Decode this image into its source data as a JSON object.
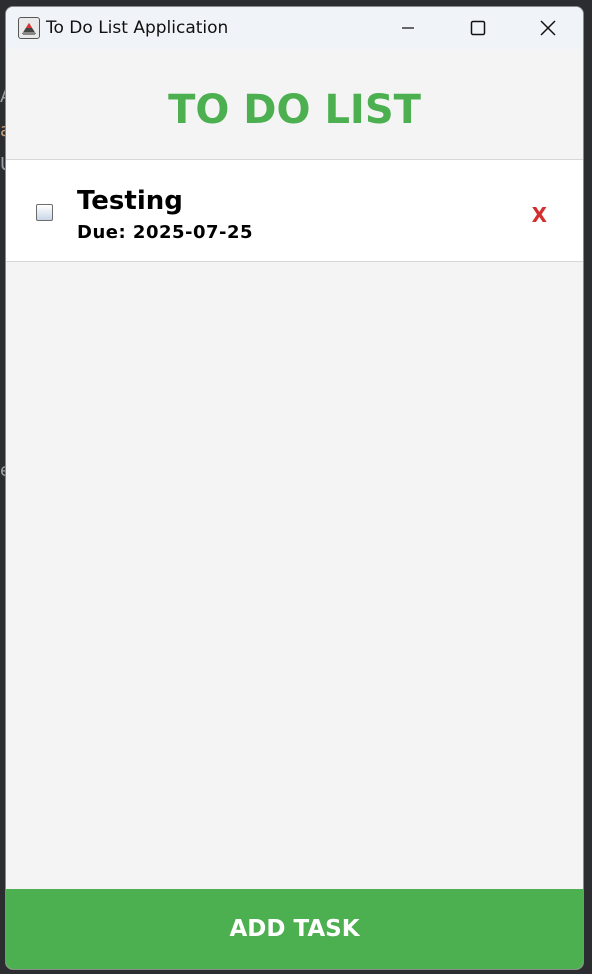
{
  "window": {
    "title": "To Do List Application"
  },
  "header": {
    "title": "TO DO LIST"
  },
  "tasks": [
    {
      "name": "Testing",
      "due": "Due: 2025-07-25",
      "completed": false,
      "delete_label": "X"
    }
  ],
  "footer": {
    "add_label": "ADD TASK"
  },
  "colors": {
    "accent": "#4caf50",
    "delete": "#d32f2f"
  }
}
